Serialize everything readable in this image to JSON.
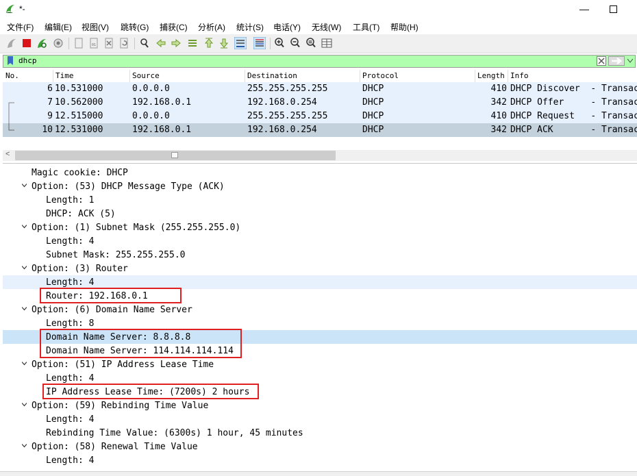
{
  "window": {
    "title": "*-"
  },
  "menu": [
    "文件(F)",
    "编辑(E)",
    "视图(V)",
    "跳转(G)",
    "捕获(C)",
    "分析(A)",
    "统计(S)",
    "电话(Y)",
    "无线(W)",
    "工具(T)",
    "帮助(H)"
  ],
  "filter": {
    "value": "dhcp"
  },
  "packet_list": {
    "columns": [
      "No.",
      "Time",
      "Source",
      "Destination",
      "Protocol",
      "Length",
      "Info"
    ],
    "rows": [
      {
        "no": "6",
        "time": "10.531000",
        "src": "0.0.0.0",
        "dst": "255.255.255.255",
        "proto": "DHCP",
        "len": "410",
        "info": "DHCP Discover  - Transac"
      },
      {
        "no": "7",
        "time": "10.562000",
        "src": "192.168.0.1",
        "dst": "192.168.0.254",
        "proto": "DHCP",
        "len": "342",
        "info": "DHCP Offer     - Transac"
      },
      {
        "no": "9",
        "time": "12.515000",
        "src": "0.0.0.0",
        "dst": "255.255.255.255",
        "proto": "DHCP",
        "len": "410",
        "info": "DHCP Request   - Transac"
      },
      {
        "no": "10",
        "time": "12.531000",
        "src": "192.168.0.1",
        "dst": "192.168.0.254",
        "proto": "DHCP",
        "len": "342",
        "info": "DHCP ACK       - Transac"
      }
    ]
  },
  "details": [
    "Magic cookie: DHCP",
    "Option: (53) DHCP Message Type (ACK)",
    "Length: 1",
    "DHCP: ACK (5)",
    "Option: (1) Subnet Mask (255.255.255.0)",
    "Length: 4",
    "Subnet Mask: 255.255.255.0",
    "Option: (3) Router",
    "Length: 4",
    "Router: 192.168.0.1",
    "Option: (6) Domain Name Server",
    "Length: 8",
    "Domain Name Server: 8.8.8.8",
    "Domain Name Server: 114.114.114.114",
    "Option: (51) IP Address Lease Time",
    "Length: 4",
    "IP Address Lease Time: (7200s) 2 hours",
    "Option: (59) Rebinding Time Value",
    "Length: 4",
    "Rebinding Time Value: (6300s) 1 hour, 45 minutes",
    "Option: (58) Renewal Time Value",
    "Length: 4"
  ],
  "colors": {
    "filter_ok": "#afffaf",
    "row_bg": "#e7f1fd",
    "row_selected": "#c3d1dd",
    "annotation": "#e02020"
  }
}
